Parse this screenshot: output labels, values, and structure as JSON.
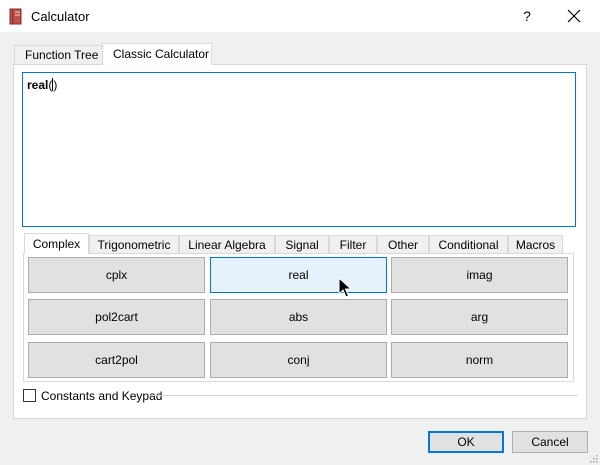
{
  "window": {
    "title": "Calculator",
    "app_icon": "calculator-book-icon",
    "help_label": "?",
    "close_icon": "close-icon"
  },
  "outer_tabs": [
    {
      "label": "Function Tree",
      "active": false
    },
    {
      "label": "Classic Calculator",
      "active": true
    }
  ],
  "editor": {
    "text": "real",
    "open_paren": "(",
    "close_paren": ")"
  },
  "inner_tabs": [
    {
      "label": "Complex",
      "active": true
    },
    {
      "label": "Trigonometric",
      "active": false
    },
    {
      "label": "Linear Algebra",
      "active": false
    },
    {
      "label": "Signal",
      "active": false
    },
    {
      "label": "Filter",
      "active": false
    },
    {
      "label": "Other",
      "active": false
    },
    {
      "label": "Conditional",
      "active": false
    },
    {
      "label": "Macros",
      "active": false
    }
  ],
  "function_buttons": [
    [
      "cplx",
      "real",
      "imag"
    ],
    [
      "pol2cart",
      "abs",
      "arg"
    ],
    [
      "cart2pol",
      "conj",
      "norm"
    ]
  ],
  "hovered_button": "real",
  "constants": {
    "label": "Constants and Keypad",
    "checked": false
  },
  "footer": {
    "ok_label": "OK",
    "cancel_label": "Cancel"
  },
  "colors": {
    "accent": "#0078d7",
    "button_face": "#e1e1e1",
    "hover_face": "#e5f1fb"
  }
}
